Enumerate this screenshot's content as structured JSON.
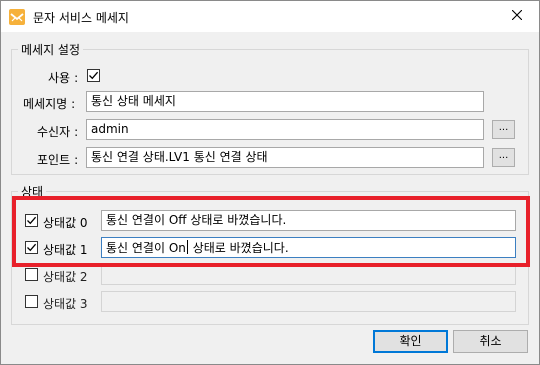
{
  "window": {
    "title": "문자 서비스 메세지",
    "icon": "app-icon",
    "close_icon": "close-icon"
  },
  "message_group": {
    "legend": "메세지 설정",
    "use_label": "사용",
    "use_checked": true,
    "name_label": "메세지명",
    "name_value": "통신 상태 메세지",
    "receiver_label": "수신자",
    "receiver_value": "admin",
    "point_label": "포인트",
    "point_value": "통신 연결 상태.LV1 통신 연결 상태",
    "browse_label": "..."
  },
  "state_group": {
    "legend": "상태",
    "colon": ":",
    "rows": [
      {
        "label": "상태값 0",
        "checked": true,
        "enabled": true,
        "value": "통신 연결이 Off 상태로 바꼈습니다."
      },
      {
        "label": "상태값 1",
        "checked": true,
        "enabled": true,
        "value_before_caret": "통신 연결이 On",
        "value_after_caret": " 상태로 바꼈습니다."
      },
      {
        "label": "상태값 2",
        "checked": false,
        "enabled": false,
        "value": ""
      },
      {
        "label": "상태값 3",
        "checked": false,
        "enabled": false,
        "value": ""
      }
    ]
  },
  "buttons": {
    "ok": "확인",
    "cancel": "취소"
  },
  "colors": {
    "highlight": "#e8202a",
    "accent": "#0078d7"
  }
}
